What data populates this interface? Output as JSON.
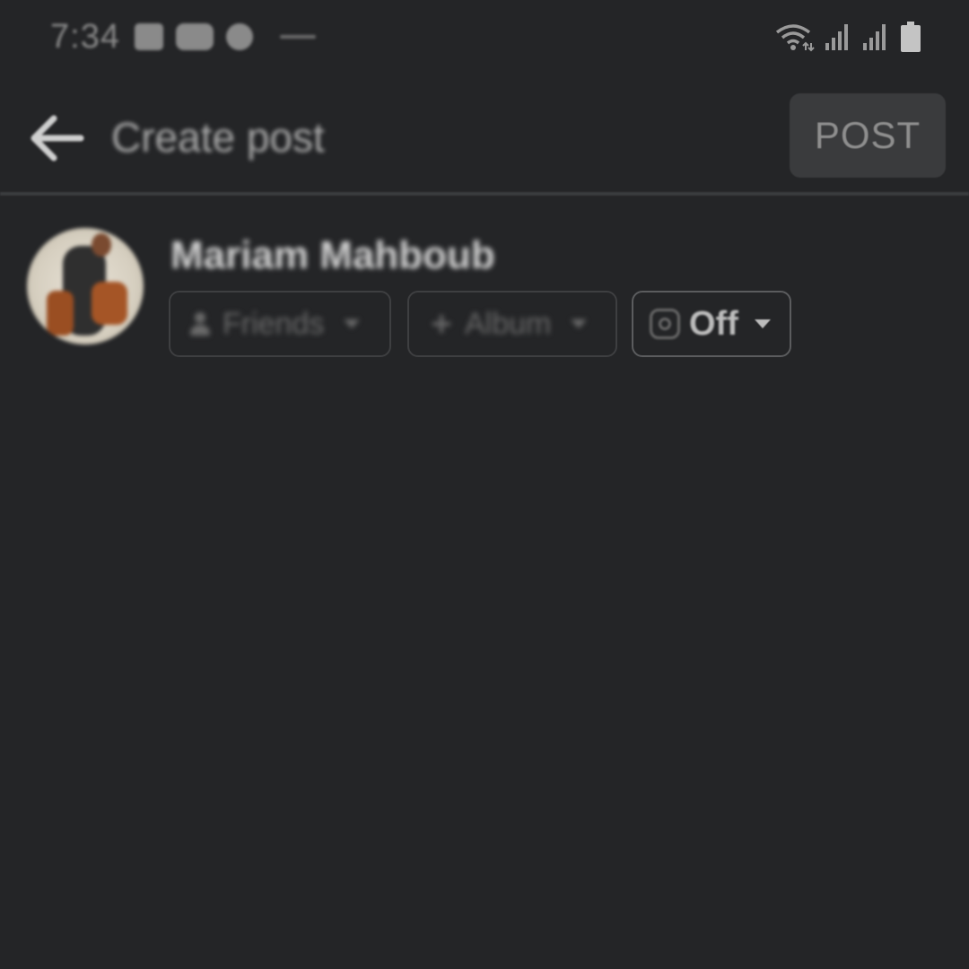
{
  "status_bar": {
    "time": "7:34",
    "notification_icons": [
      "gallery-icon",
      "youtube-icon",
      "circle-icon"
    ],
    "system_icons": [
      "wifi-icon",
      "signal-icon",
      "signal-icon",
      "battery-icon"
    ]
  },
  "app_bar": {
    "title": "Create post",
    "post_label": "POST"
  },
  "composer": {
    "user_name": "Mariam Mahboub",
    "audience_label": "Friends",
    "album_label": "Album",
    "instagram_label": "Off"
  },
  "colors": {
    "background": "#242527",
    "post_button_bg": "#3a3b3d",
    "divider": "#3b3c3e"
  }
}
